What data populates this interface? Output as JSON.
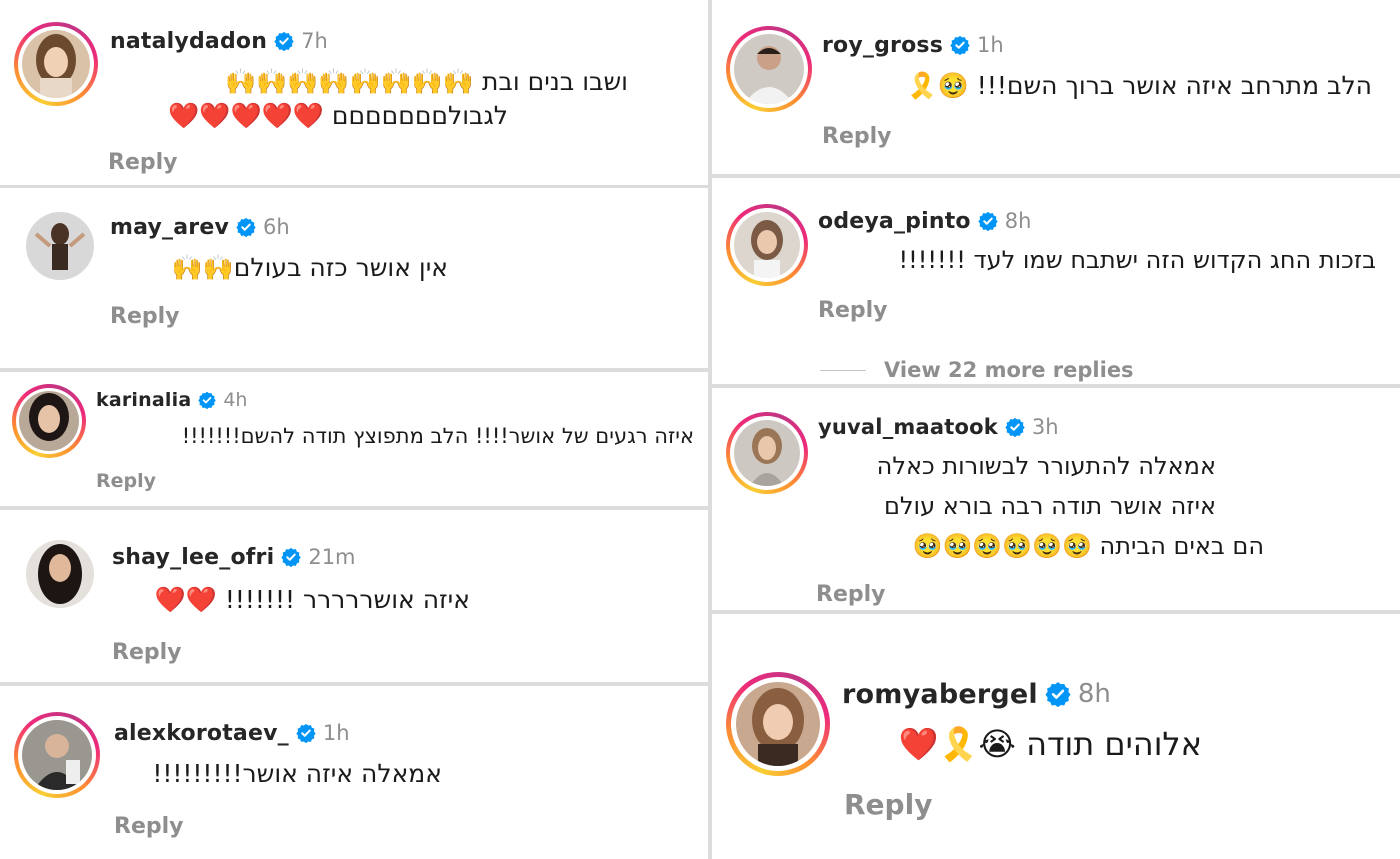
{
  "left_comments": [
    {
      "username": "natalydadon",
      "time": "7h",
      "text_line1": "ושבו בנים ובת 🙌🙌🙌🙌🙌🙌🙌🙌",
      "text_line2": "לגבולםםםםםםם ❤️❤️❤️❤️❤️",
      "reply": "Reply"
    },
    {
      "username": "may_arev",
      "time": "6h",
      "text_line1": "אין אושר כזה בעולם🙌🙌",
      "reply": "Reply"
    },
    {
      "username": "karinalia",
      "time": "4h",
      "text_line1": "איזה רגעים של אושר!!!! הלב מתפוצץ תודה להשם!!!!!!!",
      "reply": "Reply"
    },
    {
      "username": "shay_lee_ofri",
      "time": "21m",
      "text_line1": "איזה אושררררר !!!!!!! ❤️❤️",
      "reply": "Reply"
    },
    {
      "username": "alexkorotaev_",
      "time": "1h",
      "text_line1": "אמאלה איזה אושר!!!!!!!!!",
      "reply": "Reply"
    }
  ],
  "right_comments": [
    {
      "username": "roy_gross",
      "time": "1h",
      "text_line1": "הלב מתרחב איזה אושר ברוך השם!!! 🥹🎗️",
      "reply": "Reply"
    },
    {
      "username": "odeya_pinto",
      "time": "8h",
      "text_line1": "בזכות החג הקדוש הזה ישתבח שמו לעד !!!!!!!",
      "reply": "Reply",
      "view_more": "View 22 more replies"
    },
    {
      "username": "yuval_maatook",
      "time": "3h",
      "text_line1": "אמאלה להתעורר לבשורות כאלה",
      "text_line2": "איזה אושר תודה רבה בורא עולם",
      "text_line3": "הם באים הביתה 🥹🥹🥹🥹🥹🥹",
      "reply": "Reply"
    },
    {
      "username": "romyabergel",
      "time": "8h",
      "text_line1": "אלוהים תודה 😭🎗️❤️",
      "reply": "Reply"
    }
  ],
  "colors": {
    "username": "#262626",
    "timestamp": "#8e8e8e",
    "reply": "#8e8e8e",
    "verified": "#0095f6",
    "ring_start": "#f9ce34",
    "ring_mid": "#ee2a7b",
    "ring_end": "#6228d7"
  },
  "icons": {
    "verified": "verified-badge-icon",
    "avatar_ring": "story-ring"
  }
}
